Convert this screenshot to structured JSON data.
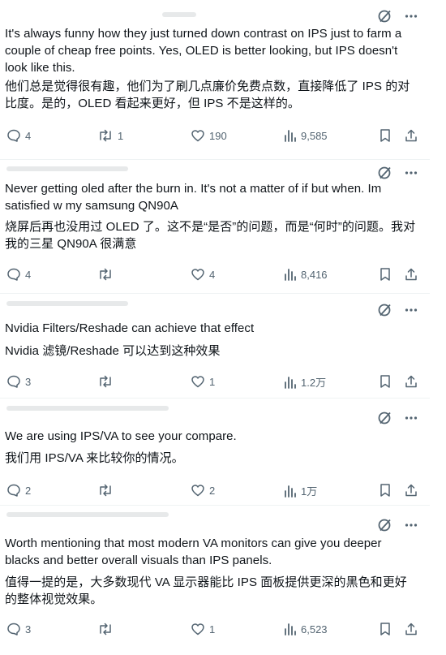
{
  "tweets": [
    {
      "text_en": "It's always funny how they just turned down contrast on IPS just to farm a couple of cheap free points. Yes, OLED is better looking, but IPS doesn't look like this.",
      "text_zh": "他们总是觉得很有趣，他们为了刷几点廉价免费点数，直接降低了 IPS 的对比度。是的，OLED 看起来更好，但 IPS 不是这样的。",
      "replies": "4",
      "reposts": "1",
      "likes": "190",
      "views": "9,585"
    },
    {
      "text_en": "Never getting oled after the burn in. It's not a matter of if but when. Im satisfied w my samsung QN90A",
      "text_zh": "烧屏后再也没用过 OLED 了。这不是“是否”的问题，而是“何时”的问题。我对我的三星 QN90A 很满意",
      "replies": "4",
      "reposts": "",
      "likes": "4",
      "views": "8,416"
    },
    {
      "text_en": "Nvidia Filters/Reshade can achieve that effect",
      "text_zh": "Nvidia 滤镜/Reshade 可以达到这种效果",
      "replies": "3",
      "reposts": "",
      "likes": "1",
      "views": "1.2万"
    },
    {
      "text_en": "We are using IPS/VA to see your compare.",
      "text_zh": "我们用 IPS/VA 来比较你的情况。",
      "replies": "2",
      "reposts": "",
      "likes": "2",
      "views": "1万"
    },
    {
      "text_en": "Worth mentioning that most modern VA monitors can give you deeper blacks and better overall visuals than IPS panels.",
      "text_zh": "值得一提的是，大多数现代 VA 显示器能比 IPS 面板提供更深的黑色和更好的整体视觉效果。",
      "replies": "3",
      "reposts": "",
      "likes": "1",
      "views": "6,523"
    }
  ],
  "icons": [
    "grok-icon",
    "more-icon",
    "reply-icon",
    "repost-icon",
    "like-icon",
    "views-icon",
    "bookmark-icon",
    "share-icon"
  ],
  "colors": {
    "text": "#0f1419",
    "muted": "#536471",
    "separator": "#eff3f4"
  }
}
